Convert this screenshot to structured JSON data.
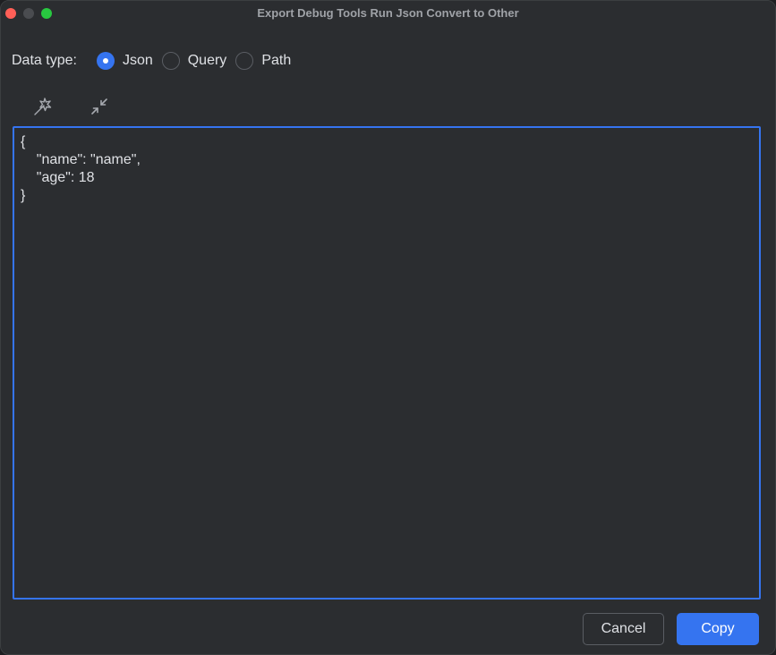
{
  "window": {
    "title": "Export Debug Tools Run Json Convert to Other"
  },
  "data_type": {
    "label": "Data type:",
    "options": [
      {
        "label": "Json",
        "selected": true
      },
      {
        "label": "Query",
        "selected": false
      },
      {
        "label": "Path",
        "selected": false
      }
    ]
  },
  "toolbar": {
    "icons": [
      "magic-wand-icon",
      "collapse-arrows-icon"
    ]
  },
  "editor": {
    "content": "{\n    \"name\": \"name\",\n    \"age\": 18\n}"
  },
  "buttons": {
    "cancel": "Cancel",
    "copy": "Copy"
  },
  "colors": {
    "accent": "#3574f0",
    "background": "#2b2d30",
    "text": "#dfe1e5"
  }
}
